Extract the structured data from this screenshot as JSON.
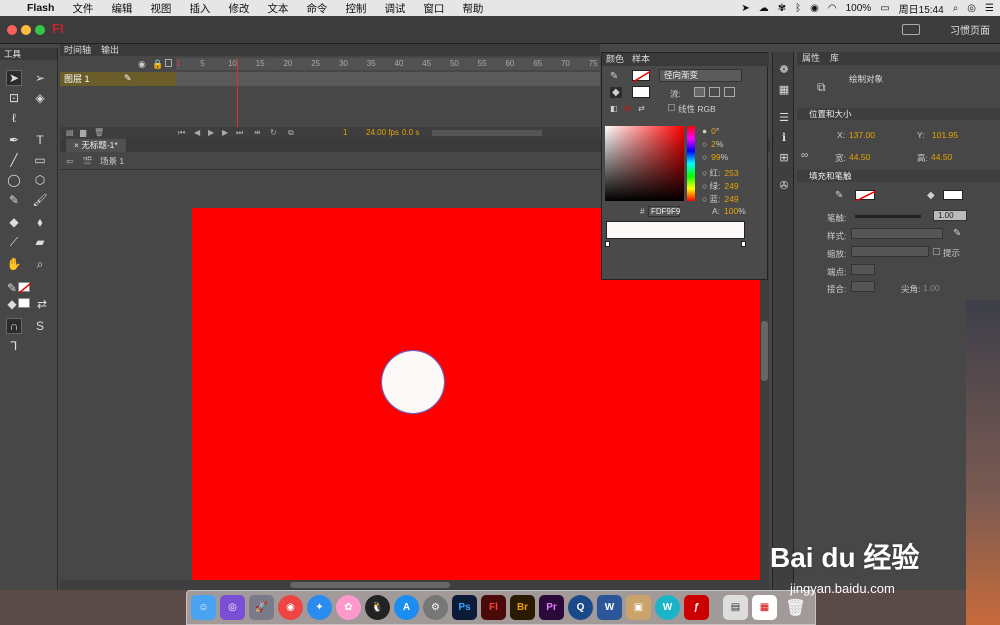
{
  "menubar": {
    "apple": "",
    "app": "Flash",
    "items": [
      "文件",
      "编辑",
      "视图",
      "插入",
      "修改",
      "文本",
      "命令",
      "控制",
      "调试",
      "窗口",
      "帮助"
    ],
    "battery": "100%",
    "datetime": "周日15:44"
  },
  "titlebar": {
    "logo": "Fl",
    "workspace": "习惯页面",
    "workspace_icon": "keyboard-icon"
  },
  "tools": {
    "header": "工具"
  },
  "timeline": {
    "tabs": [
      "时间轴",
      "输出"
    ],
    "layer": "图层 1",
    "ruler": [
      "1",
      "5",
      "10",
      "15",
      "20",
      "25",
      "30",
      "35",
      "40",
      "45",
      "50",
      "55",
      "60",
      "65",
      "70",
      "75"
    ],
    "current_frame": "1",
    "fps": "24.00 fps",
    "time": "0.0 s"
  },
  "document": {
    "tab": "无标题-1*",
    "scene": "场景 1"
  },
  "color_panel": {
    "tabs": [
      "颜色",
      "样本"
    ],
    "fill_type": "径向渐变",
    "flow_label": "流:",
    "linear_rgb": "线性 RGB",
    "h": "0",
    "h_unit": "°",
    "s": "2",
    "s_unit": "%",
    "b": "99",
    "b_unit": "%",
    "r_label": "红:",
    "r": "253",
    "g_label": "绿:",
    "g": "249",
    "bl_label": "蓝:",
    "bl": "249",
    "a_label": "A:",
    "a": "100",
    "a_unit": "%",
    "hex_label": "#",
    "hex": "FDF9F9",
    "colors": {
      "stage": "#ff0000",
      "fill": "#fdf9f9"
    }
  },
  "properties": {
    "tabs": [
      "属性",
      "库"
    ],
    "object": "绘制对象",
    "pos_section": "位置和大小",
    "x_label": "X:",
    "x": "137.00",
    "y_label": "Y:",
    "y": "101.95",
    "w_label": "宽:",
    "w": "44.50",
    "h_label": "高:",
    "h": "44.50",
    "fill_section": "填充和笔触",
    "stroke_label": "笔触:",
    "stroke": "1.00",
    "style_label": "样式:",
    "scale_label": "缩放:",
    "hint_label": "提示",
    "cap_label": "端点:",
    "join_label": "接合:",
    "miter_label": "尖角:",
    "miter": "1.00"
  },
  "watermark": {
    "logo": "Bai du 经验",
    "url": "jingyan.baidu.com"
  },
  "dock": {
    "apps": [
      "Finder",
      "Siri",
      "Launchpad",
      "Chrome",
      "Safari",
      "Photos",
      "QQ",
      "App Store",
      "System Preferences",
      "Ps",
      "Fl",
      "Br",
      "Pr",
      "QuickTime",
      "W",
      "Archive",
      "W",
      "Flash",
      "Preview",
      "Calendar",
      "Trash"
    ]
  }
}
